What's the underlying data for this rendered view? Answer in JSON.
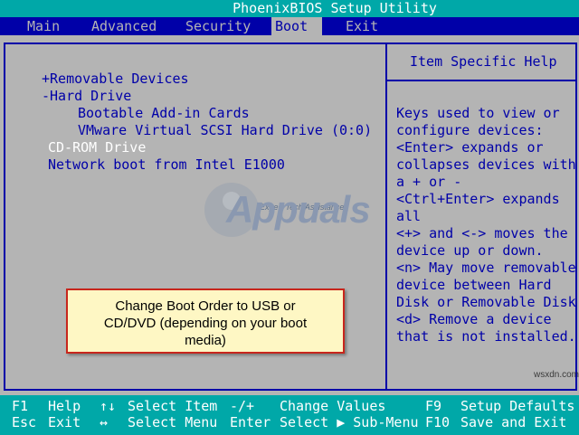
{
  "title": "PhoenixBIOS Setup Utility",
  "menu": [
    {
      "label": "Main"
    },
    {
      "label": "Advanced"
    },
    {
      "label": "Security"
    },
    {
      "label": "Boot",
      "active": true
    },
    {
      "label": "Exit"
    }
  ],
  "boot_list": {
    "removable_devices": "+Removable Devices",
    "hard_drive": "-Hard Drive",
    "bootable_addin": "Bootable Add-in Cards",
    "vmware_scsi": "VMware Virtual SCSI Hard Drive (0:0)",
    "cdrom": "CD-ROM Drive",
    "network_boot": "Network boot from Intel E1000"
  },
  "help": {
    "header": "Item Specific Help",
    "lines": [
      "Keys used to view or",
      "configure devices:",
      "<Enter> expands or",
      "collapses devices with",
      "a + or -",
      "<Ctrl+Enter> expands",
      "all",
      "<+> and <-> moves the",
      "device up or down.",
      "<n> May move removable",
      "device between Hard",
      "Disk or Removable Disk",
      "<d> Remove a device",
      "that is not installed."
    ]
  },
  "callout": {
    "lines": [
      "Change Boot Order to USB or",
      "CD/DVD (depending on your boot",
      "media)"
    ]
  },
  "watermark": {
    "tagline": "Expert Tech Assistance!",
    "brand": "Appuals",
    "site": "wsxdn.com"
  },
  "footer": {
    "row1": [
      {
        "key": "F1",
        "desc": "Help"
      },
      {
        "key": "↑↓",
        "desc": "Select Item"
      },
      {
        "key": "-/+",
        "desc": "Change Values"
      },
      {
        "key": "F9",
        "desc": "Setup Defaults"
      }
    ],
    "row2": [
      {
        "key": "Esc",
        "desc": "Exit"
      },
      {
        "key": "↔",
        "desc": "Select Menu"
      },
      {
        "key": "Enter",
        "desc": "Select ▶ Sub-Menu"
      },
      {
        "key": "F10",
        "desc": "Save and Exit"
      }
    ]
  },
  "colors": {
    "bios_blue": "#0000a8",
    "bios_cyan": "#00a8a8",
    "bios_gray": "#b4b4b4",
    "callout_bg": "#fef7c4",
    "callout_border": "#c8261c"
  }
}
